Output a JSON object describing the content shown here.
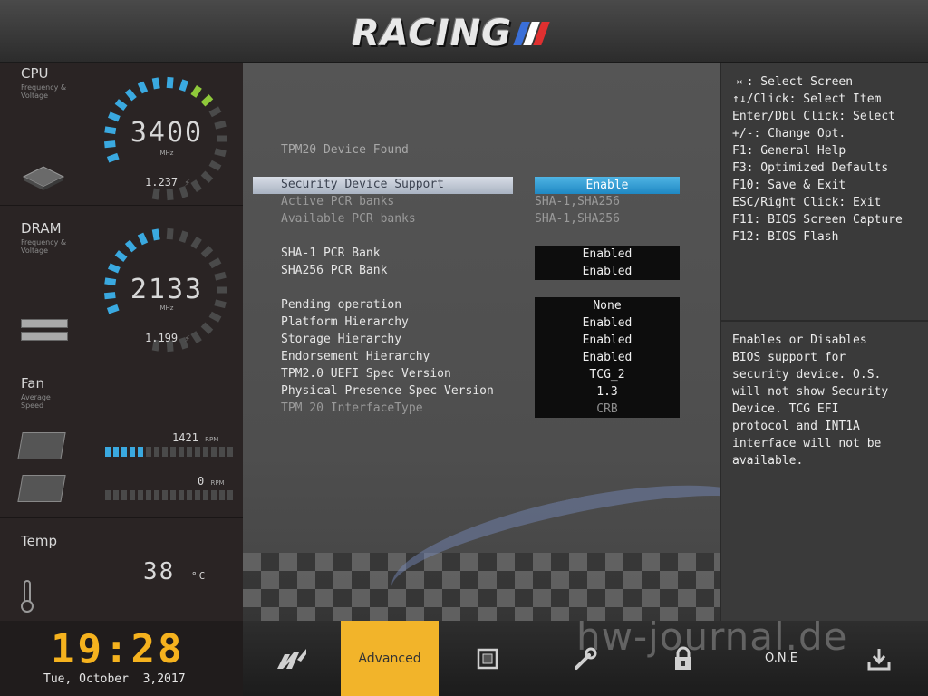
{
  "header": {
    "logo_text": "RACING",
    "logo_colors": [
      "#3a6fd8",
      "#e03030",
      "#ffffff"
    ]
  },
  "sidebar": {
    "cpu": {
      "title": "CPU",
      "subtitle": "Frequency & Voltage",
      "value": "3400",
      "unit": "MHz",
      "voltage": "1.237"
    },
    "dram": {
      "title": "DRAM",
      "subtitle": "Frequency & Voltage",
      "value": "2133",
      "unit": "MHz",
      "voltage": "1.199"
    },
    "fan": {
      "title": "Fan",
      "subtitle": "Average Speed",
      "fan1_rpm": "1421",
      "fan2_rpm": "0",
      "rpm_unit": "RPM",
      "fan1_level": 0.33,
      "fan2_level": 0
    },
    "temp": {
      "title": "Temp",
      "value": "38",
      "unit": "°C"
    }
  },
  "main": {
    "found_label": "TPM20 Device Found",
    "rows": [
      {
        "label": "Security Device Support",
        "value": "Enable",
        "style": "box",
        "selected": true
      },
      {
        "label": "Active PCR banks",
        "value": "SHA-1,SHA256",
        "style": "plain",
        "dim": true
      },
      {
        "label": "Available PCR banks",
        "value": "SHA-1,SHA256",
        "style": "plain",
        "dim": true
      },
      {
        "label": "SHA-1 PCR Bank",
        "value": "Enabled",
        "style": "box"
      },
      {
        "label": "SHA256 PCR Bank",
        "value": "Enabled",
        "style": "box"
      },
      {
        "label": "Pending operation",
        "value": "None",
        "style": "box"
      },
      {
        "label": "Platform Hierarchy",
        "value": "Enabled",
        "style": "box"
      },
      {
        "label": "Storage Hierarchy",
        "value": "Enabled",
        "style": "box"
      },
      {
        "label": "Endorsement Hierarchy",
        "value": "Enabled",
        "style": "box"
      },
      {
        "label": "TPM2.0 UEFI Spec Version",
        "value": "TCG_2",
        "style": "box"
      },
      {
        "label": "Physical Presence Spec Version",
        "value": "1.3",
        "style": "box"
      },
      {
        "label": "TPM 20 InterfaceType",
        "value": "CRB",
        "style": "box",
        "dim": true
      }
    ]
  },
  "help": {
    "keys": [
      "→←: Select Screen",
      "↑↓/Click: Select Item",
      "Enter/Dbl Click: Select",
      "+/-: Change Opt.",
      "F1: General Help",
      "F3: Optimized Defaults",
      "F10: Save & Exit",
      "ESC/Right Click: Exit",
      "F11: BIOS Screen Capture",
      "F12: BIOS Flash"
    ],
    "description": [
      "Enables or Disables",
      "BIOS support for",
      "security device. O.S.",
      "will not show Security",
      "Device. TCG EFI",
      "protocol and INT1A",
      "interface will not be",
      "available."
    ]
  },
  "bottom": {
    "time": "19:28",
    "date": "Tue, October  3,2017",
    "tabs": [
      {
        "name": "racing-logo-icon",
        "label": ""
      },
      {
        "name": "advanced",
        "label": "Advanced",
        "active": true
      },
      {
        "name": "chip-icon",
        "label": ""
      },
      {
        "name": "tool-icon",
        "label": ""
      },
      {
        "name": "lock-icon",
        "label": ""
      },
      {
        "name": "one",
        "label": "O.N.E"
      },
      {
        "name": "save-icon",
        "label": ""
      }
    ],
    "watermark": "hw-journal.de"
  },
  "colors": {
    "accent_blue": "#3aa9e0",
    "accent_green": "#8fc93a",
    "active_tab": "#f2b42a",
    "clock": "#f5b21e"
  }
}
